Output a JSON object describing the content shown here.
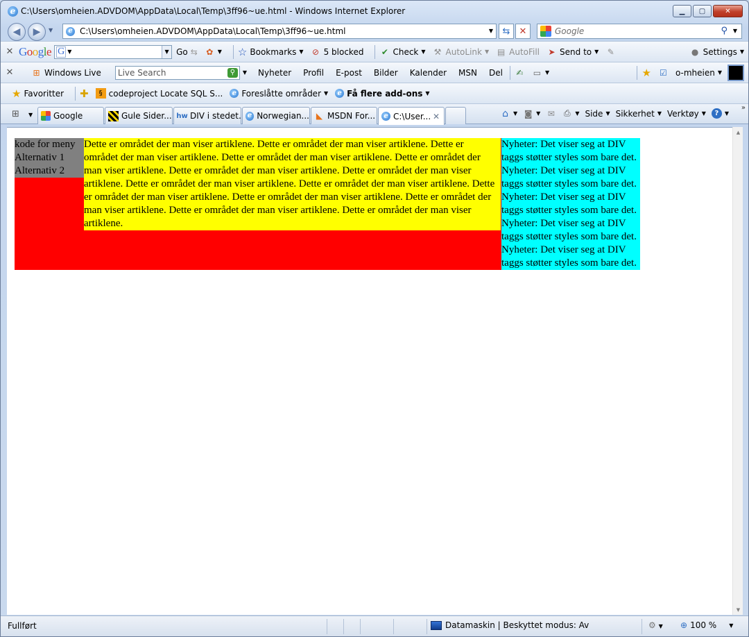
{
  "window": {
    "title": "C:\\Users\\omheien.ADVDOM\\AppData\\Local\\Temp\\3ff96~ue.html - Windows Internet Explorer"
  },
  "address": {
    "url": "C:\\Users\\omheien.ADVDOM\\AppData\\Local\\Temp\\3ff96~ue.html",
    "search_placeholder": "Google"
  },
  "google_toolbar": {
    "logo": "Google",
    "go_label": "Go",
    "bookmarks_label": "Bookmarks",
    "blocked_label": "5 blocked",
    "check_label": "Check",
    "autolink_label": "AutoLink",
    "autofill_label": "AutoFill",
    "sendto_label": "Send to",
    "settings_label": "Settings"
  },
  "live_toolbar": {
    "windows_live_label": "Windows Live",
    "live_search_placeholder": "Live Search",
    "links": [
      "Nyheter",
      "Profil",
      "E-post",
      "Bilder",
      "Kalender",
      "MSN",
      "Del"
    ],
    "user_label": "o-mheien"
  },
  "favorites_bar": {
    "favorites_label": "Favoritter",
    "items": [
      {
        "label": "codeproject Locate SQL S...",
        "icon": "codeproject-icon"
      },
      {
        "label": "Foreslåtte områder",
        "icon": "ie-icon"
      },
      {
        "label": "Få flere add-ons",
        "icon": "ie-page-icon"
      }
    ]
  },
  "tabs": [
    {
      "label": "Google",
      "icon": "google-icon"
    },
    {
      "label": "Gule Sider...",
      "icon": "gulesider-icon"
    },
    {
      "label": "DIV i stedet...",
      "icon": "hw-icon"
    },
    {
      "label": "Norwegian...",
      "icon": "ie-icon"
    },
    {
      "label": "MSDN For...",
      "icon": "msdn-icon"
    },
    {
      "label": "C:\\User...",
      "icon": "ie-icon"
    }
  ],
  "command_bar": {
    "side_label": "Side",
    "sikkerhet_label": "Sikkerhet",
    "verktoy_label": "Verktøy"
  },
  "page": {
    "menu": [
      "kode for meny",
      "Alternativ 1",
      "Alternativ 2"
    ],
    "article": "Dette er området der man viser artiklene. Dette er området der man viser artiklene. Dette er området der man viser artiklene. Dette er området der man viser artiklene. Dette er området der man viser artiklene. Dette er området der man viser artiklene. Dette er området der man viser artiklene. Dette er området der man viser artiklene. Dette er området der man viser artiklene. Dette er området der man viser artiklene. Dette er området der man viser artiklene. Dette er området der man viser artiklene. Dette er området der man viser artiklene. Dette er området der man viser artiklene.",
    "news": "Nyheter: Det viser seg at DIV taggs støtter styles som bare det. Nyheter: Det viser seg at DIV taggs støtter styles som bare det. Nyheter: Det viser seg at DIV taggs støtter styles som bare det. Nyheter: Det viser seg at DIV taggs støtter styles som bare det. Nyheter: Det viser seg at DIV taggs støtter styles som bare det.",
    "colors": {
      "menu": "#808080",
      "article": "#ffff00",
      "wrapper": "#ff0000",
      "news": "#00ffff"
    }
  },
  "status": {
    "text": "Fullført",
    "zone": "Datamaskin | Beskyttet modus: Av",
    "zoom": "100 %"
  }
}
